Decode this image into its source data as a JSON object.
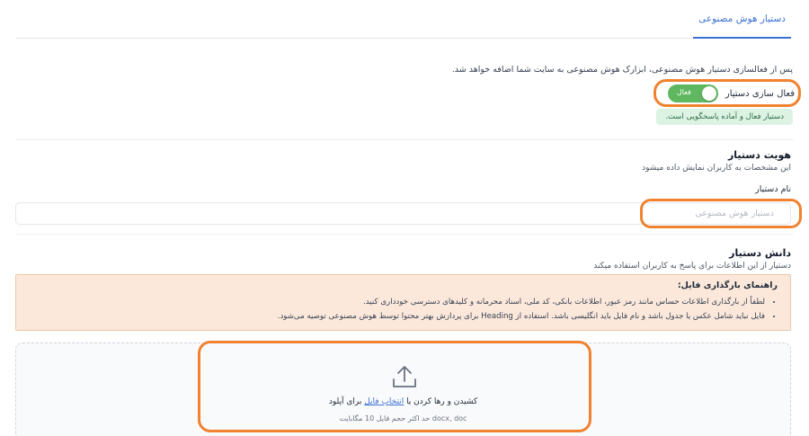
{
  "tabs": [
    {
      "label": "دستیار هوش مصنوعی",
      "active": true
    }
  ],
  "intro_text": "پس از فعالسازی دستیار هوش مصنوعی، ابزارک هوش مصنوعی به سایت شما اضافه خواهد شد.",
  "activation": {
    "label": "فعال سازی دستیار",
    "toggle_text": "فعال",
    "enabled": true,
    "status_message": "دستیار فعال و آماده پاسخگویی است."
  },
  "identity": {
    "title": "هویت دستیار",
    "subtitle": "این مشخصات به کاربران نمایش داده میشود",
    "name_label": "نام دستیار",
    "name_placeholder": "دستیار هوش مصنوعی",
    "name_value": ""
  },
  "knowledge": {
    "title": "دانش دستیار",
    "subtitle": "دستیار از این اطلاعات برای پاسخ به کاربران استفاده میکند",
    "guide_title": "راهنمای بارگذاری فایل:",
    "guide_items": [
      "لطفاً از بارگذاری اطلاعات حساس مانند رمز عبور، اطلاعات بانکی، کد ملی، اسناد محرمانه و کلیدهای دسترسی خودداری کنید.",
      "فایل نباید شامل عکس یا جدول باشد و نام فایل باید انگلیسی باشد. استفاده از Heading برای پردازش بهتر محتوا توسط هوش مصنوعی توصیه می‌شود."
    ]
  },
  "upload": {
    "icon": "upload-icon",
    "text_before": "کشیدن و رها کردن یا ",
    "link_text": "انتخاب فایل",
    "text_after": " برای آپلود",
    "hint": "docx, doc حد اکثر حجم فایل 10 مگابایت"
  },
  "colors": {
    "accent": "#3b6fd4",
    "toggle_on": "#5fb760",
    "highlight": "#f08230",
    "guide_bg": "#fbe8db",
    "status_bg": "#dcf3e4"
  }
}
